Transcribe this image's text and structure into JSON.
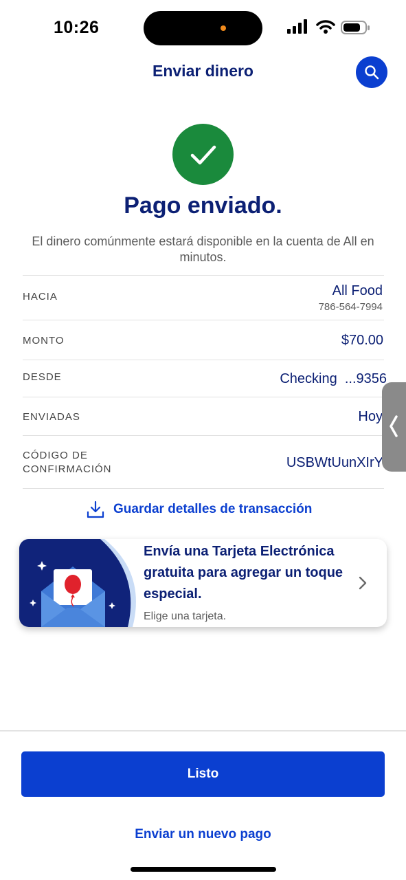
{
  "status_bar": {
    "time": "10:26",
    "icons": [
      "signal-icon",
      "wifi-icon",
      "battery-icon"
    ]
  },
  "header": {
    "title": "Enviar dinero",
    "search_icon": "search-icon"
  },
  "success": {
    "icon": "checkmark-icon",
    "title": "Pago enviado.",
    "subtitle": "El dinero comúnmente estará disponible en la cuenta de All en minutos."
  },
  "details": {
    "to": {
      "label": "HACIA",
      "name": "All Food",
      "phone": "786-564-7994"
    },
    "amount": {
      "label": "MONTO",
      "value": "$70.00"
    },
    "from": {
      "label": "DESDE",
      "value": "Checking  ...9356"
    },
    "sent": {
      "label": "ENVIADAS",
      "value": "Hoy"
    },
    "confirmation": {
      "label_line1": "CÓDIGO DE",
      "label_line2": "CONFIRMACIÓN",
      "value": "USBWtUunXIrY"
    }
  },
  "save_details": {
    "label": "Guardar detalles de transacción",
    "icon": "download-icon"
  },
  "ecard": {
    "title": "Envía una Tarjeta Electrónica gratuita para agregar un toque especial.",
    "subtitle": "Elige una tarjeta.",
    "icon": "envelope-balloon-icon"
  },
  "actions": {
    "done_label": "Listo",
    "new_payment_label": "Enviar un nuevo pago"
  },
  "colors": {
    "brand_blue": "#0b3fd0",
    "navy_text": "#0c2074",
    "success_green": "#1a8a3c"
  }
}
